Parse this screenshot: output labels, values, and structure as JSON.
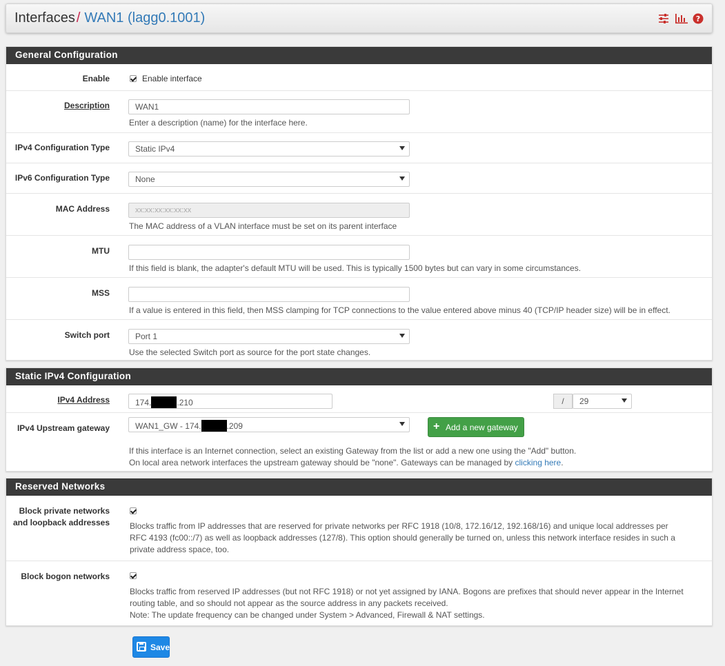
{
  "breadcrumb": {
    "part1": "Interfaces",
    "separator": "/",
    "part2": "WAN1 (lagg0.1001)"
  },
  "header_icons": [
    "sliders-icon",
    "bar-chart-icon",
    "help-icon"
  ],
  "colors": {
    "panel_head": "#3a3a3a",
    "link": "#337ab7",
    "crumb_sep": "#c7254e",
    "success": "#43a047",
    "primary": "#1e88e5",
    "icon_red": "#c9302c"
  },
  "general": {
    "title": "General Configuration",
    "enable": {
      "label": "Enable",
      "checked": true,
      "text": "Enable interface"
    },
    "description": {
      "label": "Description",
      "value": "WAN1",
      "help": "Enter a description (name) for the interface here."
    },
    "ipv4_type": {
      "label": "IPv4 Configuration Type",
      "value": "Static IPv4"
    },
    "ipv6_type": {
      "label": "IPv6 Configuration Type",
      "value": "None"
    },
    "mac": {
      "label": "MAC Address",
      "placeholder": "xx:xx:xx:xx:xx:xx",
      "help": "The MAC address of a VLAN interface must be set on its parent interface"
    },
    "mtu": {
      "label": "MTU",
      "value": "",
      "help": "If this field is blank, the adapter's default MTU will be used. This is typically 1500 bytes but can vary in some circumstances."
    },
    "mss": {
      "label": "MSS",
      "value": "",
      "help": "If a value is entered in this field, then MSS clamping for TCP connections to the value entered above minus 40 (TCP/IP header size) will be in effect."
    },
    "switch_port": {
      "label": "Switch port",
      "value": "Port 1",
      "help": "Use the selected Switch port as source for the port state changes."
    }
  },
  "static_ipv4": {
    "title": "Static IPv4 Configuration",
    "address": {
      "label": "IPv4 Address",
      "prefix": "174.",
      "suffix": ".210",
      "cidr_slash": "/",
      "cidr": "29"
    },
    "gateway": {
      "label": "IPv4 Upstream gateway",
      "prefix": "WAN1_GW - 174.",
      "suffix": ".209",
      "add_button": "Add a new gateway",
      "help1": "If this interface is an Internet connection, select an existing Gateway from the list or add a new one using the \"Add\" button.",
      "help2": "On local area network interfaces the upstream gateway should be \"none\". Gateways can be managed by ",
      "help_link": "clicking here",
      "help_end": "."
    }
  },
  "reserved": {
    "title": "Reserved Networks",
    "private": {
      "label_line1": "Block private networks",
      "label_line2": "and loopback addresses",
      "checked": true,
      "help1": "Blocks traffic from IP addresses that are reserved for private networks per RFC 1918 (10/8, 172.16/12, 192.168/16) and unique local addresses per",
      "help2": "RFC 4193 (fc00::/7) as well as loopback addresses (127/8). This option should generally be turned on, unless this network interface resides in such a",
      "help3": "private address space, too."
    },
    "bogon": {
      "label": "Block bogon networks",
      "checked": true,
      "help1": "Blocks traffic from reserved IP addresses (but not RFC 1918) or not yet assigned by IANA. Bogons are prefixes that should never appear in the Internet",
      "help2": "routing table, and so should not appear as the source address in any packets received.",
      "help3": "Note: The update frequency can be changed under System > Advanced, Firewall & NAT settings."
    }
  },
  "save_label": "Save"
}
